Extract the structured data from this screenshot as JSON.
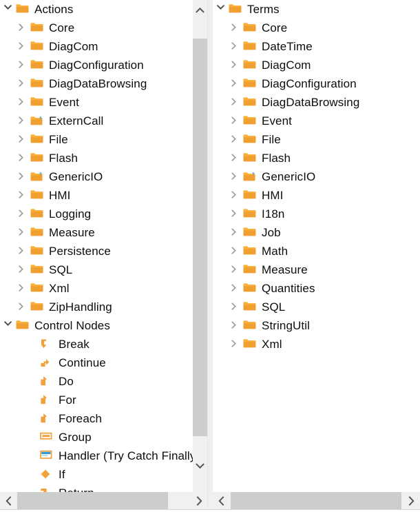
{
  "colors": {
    "folder_orange": "#f0a030",
    "folder_orange_light": "#fbb03b",
    "node_orange": "#f2a03c",
    "badge_blue": "#2e9bd6",
    "text": "#0d0d0d",
    "twisty_gray": "#9d9d9d",
    "scrollbar_track": "#f0f0f0",
    "scrollbar_thumb": "#cdcdcd",
    "panel_bg": "#ffffff",
    "window_bg": "#f0f0f0"
  },
  "left_panel": {
    "name": "actions-tree",
    "scroll": {
      "vertical": {
        "up_icon": "chevron-up-icon",
        "down_icon": "chevron-down-icon",
        "thumb_position": "top"
      },
      "horizontal": {
        "left_icon": "chevron-left-icon",
        "right_icon": "chevron-right-icon"
      }
    },
    "items": [
      {
        "label": "Actions",
        "indent": 0,
        "twisty": "expanded",
        "icon": "folder-icon"
      },
      {
        "label": "Core",
        "indent": 1,
        "twisty": "collapsed",
        "icon": "folder-icon"
      },
      {
        "label": "DiagCom",
        "indent": 1,
        "twisty": "collapsed",
        "icon": "folder-icon"
      },
      {
        "label": "DiagConfiguration",
        "indent": 1,
        "twisty": "collapsed",
        "icon": "folder-icon"
      },
      {
        "label": "DiagDataBrowsing",
        "indent": 1,
        "twisty": "collapsed",
        "icon": "folder-icon"
      },
      {
        "label": "Event",
        "indent": 1,
        "twisty": "collapsed",
        "icon": "folder-icon"
      },
      {
        "label": "ExternCall",
        "indent": 1,
        "twisty": "collapsed",
        "icon": "folder-script-icon"
      },
      {
        "label": "File",
        "indent": 1,
        "twisty": "collapsed",
        "icon": "folder-icon"
      },
      {
        "label": "Flash",
        "indent": 1,
        "twisty": "collapsed",
        "icon": "folder-icon"
      },
      {
        "label": "GenericIO",
        "indent": 1,
        "twisty": "collapsed",
        "icon": "folder-script-icon"
      },
      {
        "label": "HMI",
        "indent": 1,
        "twisty": "collapsed",
        "icon": "folder-icon"
      },
      {
        "label": "Logging",
        "indent": 1,
        "twisty": "collapsed",
        "icon": "folder-icon"
      },
      {
        "label": "Measure",
        "indent": 1,
        "twisty": "collapsed",
        "icon": "folder-icon"
      },
      {
        "label": "Persistence",
        "indent": 1,
        "twisty": "collapsed",
        "icon": "folder-icon"
      },
      {
        "label": "SQL",
        "indent": 1,
        "twisty": "collapsed",
        "icon": "folder-icon"
      },
      {
        "label": "Xml",
        "indent": 1,
        "twisty": "collapsed",
        "icon": "folder-icon"
      },
      {
        "label": "ZipHandling",
        "indent": 1,
        "twisty": "collapsed",
        "icon": "folder-icon"
      },
      {
        "label": "Control Nodes",
        "indent": 0,
        "twisty": "expanded",
        "icon": "folder-icon"
      },
      {
        "label": "Break",
        "indent": 2,
        "twisty": "none",
        "icon": "break-arrow-icon"
      },
      {
        "label": "Continue",
        "indent": 2,
        "twisty": "none",
        "icon": "continue-arrow-icon"
      },
      {
        "label": "Do",
        "indent": 2,
        "twisty": "none",
        "icon": "loop-arrow-icon"
      },
      {
        "label": "For",
        "indent": 2,
        "twisty": "none",
        "icon": "loop-arrow-icon"
      },
      {
        "label": "Foreach",
        "indent": 2,
        "twisty": "none",
        "icon": "loop-arrow-icon"
      },
      {
        "label": "Group",
        "indent": 2,
        "twisty": "none",
        "icon": "group-box-icon"
      },
      {
        "label": "Handler (Try Catch Finally)",
        "indent": 2,
        "twisty": "none",
        "icon": "handler-box-icon"
      },
      {
        "label": "If",
        "indent": 2,
        "twisty": "none",
        "icon": "diamond-icon"
      },
      {
        "label": "Return",
        "indent": 2,
        "twisty": "none",
        "icon": "return-arrow-icon"
      }
    ]
  },
  "right_panel": {
    "name": "terms-tree",
    "scroll": {
      "horizontal": {
        "left_icon": "chevron-left-icon",
        "right_icon": "chevron-right-icon"
      }
    },
    "items": [
      {
        "label": "Terms",
        "indent": 0,
        "twisty": "expanded",
        "icon": "folder-icon"
      },
      {
        "label": "Core",
        "indent": 1,
        "twisty": "collapsed",
        "icon": "folder-icon"
      },
      {
        "label": "DateTime",
        "indent": 1,
        "twisty": "collapsed",
        "icon": "folder-icon"
      },
      {
        "label": "DiagCom",
        "indent": 1,
        "twisty": "collapsed",
        "icon": "folder-icon"
      },
      {
        "label": "DiagConfiguration",
        "indent": 1,
        "twisty": "collapsed",
        "icon": "folder-icon"
      },
      {
        "label": "DiagDataBrowsing",
        "indent": 1,
        "twisty": "collapsed",
        "icon": "folder-icon"
      },
      {
        "label": "Event",
        "indent": 1,
        "twisty": "collapsed",
        "icon": "folder-icon"
      },
      {
        "label": "File",
        "indent": 1,
        "twisty": "collapsed",
        "icon": "folder-icon"
      },
      {
        "label": "Flash",
        "indent": 1,
        "twisty": "collapsed",
        "icon": "folder-icon"
      },
      {
        "label": "GenericIO",
        "indent": 1,
        "twisty": "collapsed",
        "icon": "folder-script-icon"
      },
      {
        "label": "HMI",
        "indent": 1,
        "twisty": "collapsed",
        "icon": "folder-icon"
      },
      {
        "label": "I18n",
        "indent": 1,
        "twisty": "collapsed",
        "icon": "folder-icon"
      },
      {
        "label": "Job",
        "indent": 1,
        "twisty": "collapsed",
        "icon": "folder-icon"
      },
      {
        "label": "Math",
        "indent": 1,
        "twisty": "collapsed",
        "icon": "folder-icon"
      },
      {
        "label": "Measure",
        "indent": 1,
        "twisty": "collapsed",
        "icon": "folder-icon"
      },
      {
        "label": "Quantities",
        "indent": 1,
        "twisty": "collapsed",
        "icon": "folder-icon"
      },
      {
        "label": "SQL",
        "indent": 1,
        "twisty": "collapsed",
        "icon": "folder-icon"
      },
      {
        "label": "StringUtil",
        "indent": 1,
        "twisty": "collapsed",
        "icon": "folder-icon"
      },
      {
        "label": "Xml",
        "indent": 1,
        "twisty": "collapsed",
        "icon": "folder-icon"
      }
    ]
  }
}
